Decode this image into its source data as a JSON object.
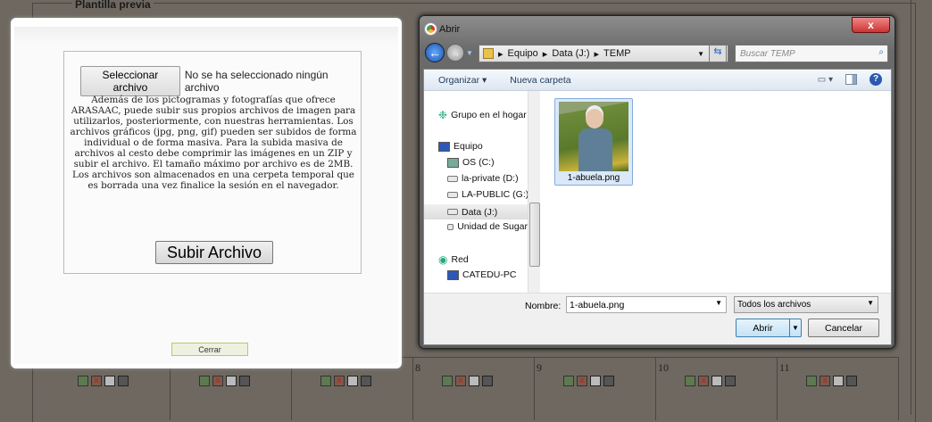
{
  "background": {
    "legend": "Plantilla previa",
    "cells": [
      {
        "num": ""
      },
      {
        "num": ""
      },
      {
        "num": ""
      },
      {
        "num": "8"
      },
      {
        "num": "9"
      },
      {
        "num": "10"
      },
      {
        "num": "11"
      }
    ]
  },
  "modal": {
    "select_button": "Seleccionar archivo",
    "no_file": "No se ha seleccionado ningún archivo",
    "description": "Además de los pictogramas y fotografías que ofrece ARASAAC, puede subir sus propios archivos de imagen para utilizarlos, posteriormente, con nuestras herramientas. Los archivos gráficos (jpg, png, gif) pueden ser subidos de forma individual o de forma masiva. Para la subida masiva de archivos al cesto debe comprimir las imágenes en un ZIP y subir el archivo. El tamaño máximo por archivo es de 2MB. Los archivos son almacenados en una cerpeta temporal que es borrada una vez finalice la sesión en el navegador.",
    "upload_button": "Subir Archivo",
    "close_button": "Cerrar"
  },
  "dialog": {
    "title": "Abrir",
    "close": "x",
    "breadcrumb": [
      "Equipo",
      "Data (J:)",
      "TEMP"
    ],
    "search_placeholder": "Buscar TEMP",
    "toolbar": {
      "organize": "Organizar ▾",
      "new_folder": "Nueva carpeta"
    },
    "sidebar": [
      "Grupo en el hogar",
      "Equipo",
      "OS (C:)",
      "la-private (D:)",
      "LA-PUBLIC (G:)",
      "Data (J:)",
      "Unidad de Sugar",
      "Red",
      "CATEDU-PC"
    ],
    "file": "1-abuela.png",
    "name_label": "Nombre:",
    "name_value": "1-abuela.png",
    "filter": "Todos los archivos",
    "open": "Abrir",
    "cancel": "Cancelar"
  }
}
